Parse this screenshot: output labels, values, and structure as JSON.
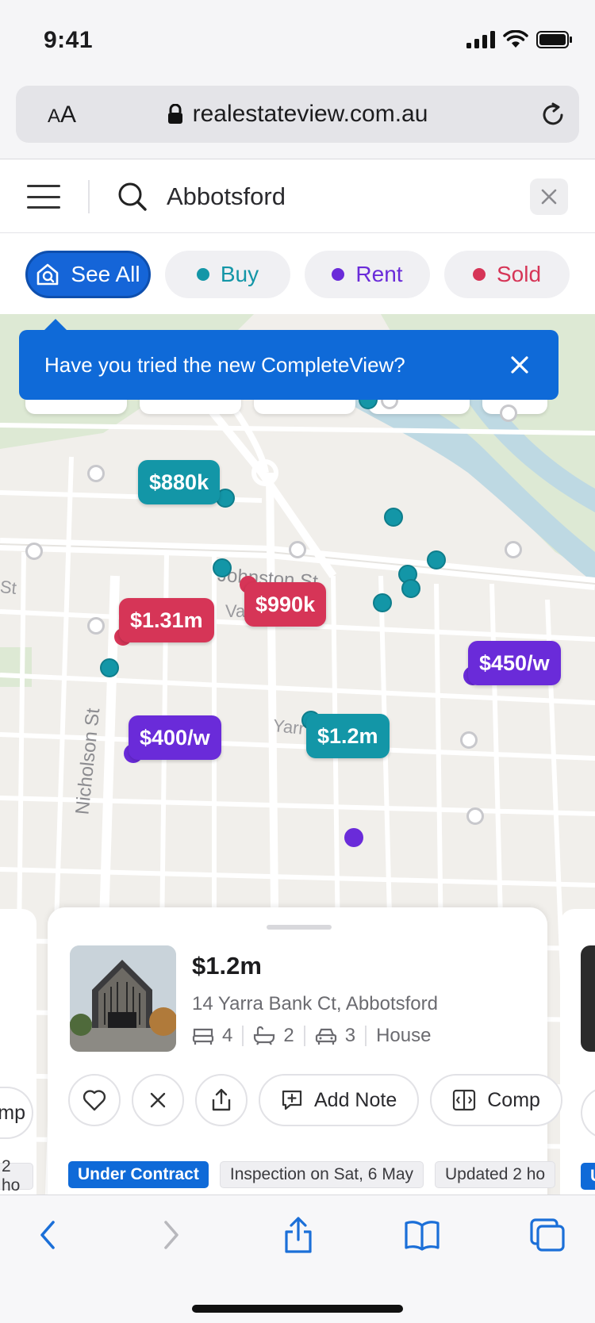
{
  "status_bar": {
    "time": "9:41"
  },
  "browser": {
    "text_size_small": "A",
    "text_size_big": "A",
    "url": "realestateview.com.au"
  },
  "search": {
    "value": "Abbotsford",
    "placeholder": ""
  },
  "filters": [
    {
      "label": "See All",
      "color": "#1565d8"
    },
    {
      "label": "Buy",
      "color": "#1396a7"
    },
    {
      "label": "Rent",
      "color": "#6a2bd9"
    },
    {
      "label": "Sold",
      "color": "#d63557"
    }
  ],
  "tooltip": {
    "text": "Have you tried the new CompleteView?"
  },
  "map": {
    "street_labels": [
      "Johnston St",
      "Nicholson St",
      "Yarr",
      "Va",
      "St"
    ],
    "price_pins": [
      {
        "label": "$880k",
        "type": "buy"
      },
      {
        "label": "$1.31m",
        "type": "sold"
      },
      {
        "label": "$990k",
        "type": "sold"
      },
      {
        "label": "$450/w",
        "type": "rent"
      },
      {
        "label": "$400/w",
        "type": "rent"
      },
      {
        "label": "$1.2m",
        "type": "buy"
      }
    ]
  },
  "listing": {
    "price": "$1.2m",
    "address": "14 Yarra Bank Ct, Abbotsford",
    "beds": "4",
    "baths": "2",
    "cars": "3",
    "property_type": "House",
    "actions": {
      "add_note": "Add Note",
      "compare": "Comp"
    },
    "tags": [
      "Under Contract",
      "Inspection on Sat, 6 May",
      "Updated 2 ho"
    ]
  },
  "side_cards": {
    "left_button": "omp",
    "left_tag": "2 ho",
    "right_tag": "U"
  }
}
